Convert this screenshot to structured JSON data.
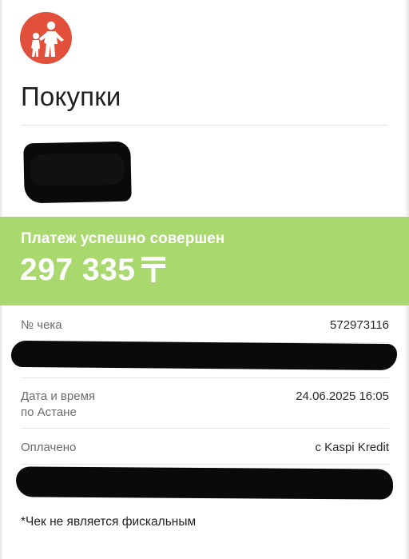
{
  "header": {
    "logo_icon": "people-logo-icon",
    "title": "Покупки"
  },
  "payment": {
    "status_text": "Платеж успешно совершен",
    "amount": "297 335",
    "currency_icon": "tenge-icon",
    "band_color": "#a9d86e"
  },
  "details": {
    "receipt": {
      "label": "№ чека",
      "value": "572973116"
    },
    "datetime": {
      "label_line1": "Дата и время",
      "label_line2": "по Астане",
      "value": "24.06.2025 16:05"
    },
    "paid": {
      "label": "Оплачено",
      "value": "с Kaspi Kredit"
    }
  },
  "footnote": "*Чек не является фискальным"
}
